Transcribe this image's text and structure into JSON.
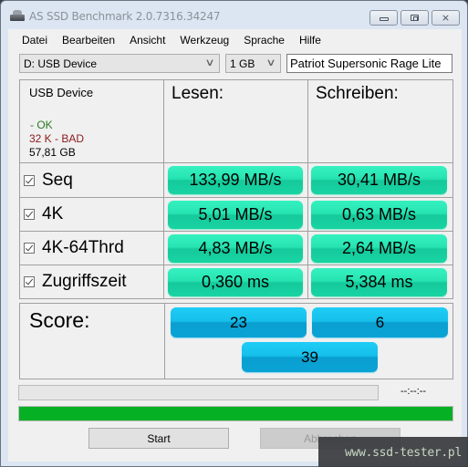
{
  "window": {
    "title": "AS SSD Benchmark 2.0.7316.34247",
    "icon": "drive-icon",
    "controls": {
      "minimize": "minimize-icon",
      "maximize": "maximize-icon",
      "close": "close-icon",
      "close_glyph": "⨯"
    }
  },
  "menu": [
    "Datei",
    "Bearbeiten",
    "Ansicht",
    "Werkzeug",
    "Sprache",
    "Hilfe"
  ],
  "toolbar": {
    "drive_select": "D: USB Device",
    "size_select": "1 GB",
    "device_name": "Patriot Supersonic Rage Lite",
    "chevron": "∨"
  },
  "device_info": {
    "name": "USB Device",
    "driver_status": " - OK",
    "alignment_status": "32 K - BAD",
    "capacity": "57,81 GB"
  },
  "columns": {
    "read": "Lesen:",
    "write": "Schreiben:"
  },
  "tests": [
    {
      "label": "Seq",
      "checked": true,
      "read": "133,99 MB/s",
      "write": "30,41 MB/s"
    },
    {
      "label": "4K",
      "checked": true,
      "read": "5,01 MB/s",
      "write": "0,63 MB/s"
    },
    {
      "label": "4K-64Thrd",
      "checked": true,
      "read": "4,83 MB/s",
      "write": "2,64 MB/s"
    },
    {
      "label": "Zugriffszeit",
      "checked": true,
      "read": "0,360 ms",
      "write": "5,384 ms"
    }
  ],
  "score": {
    "label": "Score:",
    "read": "23",
    "write": "6",
    "total": "39"
  },
  "progress": {
    "elapsed": "--:--:--",
    "step_progress_percent": 0,
    "total_progress_percent": 100
  },
  "buttons": {
    "start": "Start",
    "abort": "Abbrechen",
    "abort_enabled": false
  },
  "watermark": "www.ssd-tester.pl",
  "colors": {
    "result_green": "#26e4b1",
    "score_blue": "#16c0ea",
    "progress_green": "#06b025",
    "ok_text": "#2a7a1f",
    "bad_text": "#8b1a1a"
  }
}
